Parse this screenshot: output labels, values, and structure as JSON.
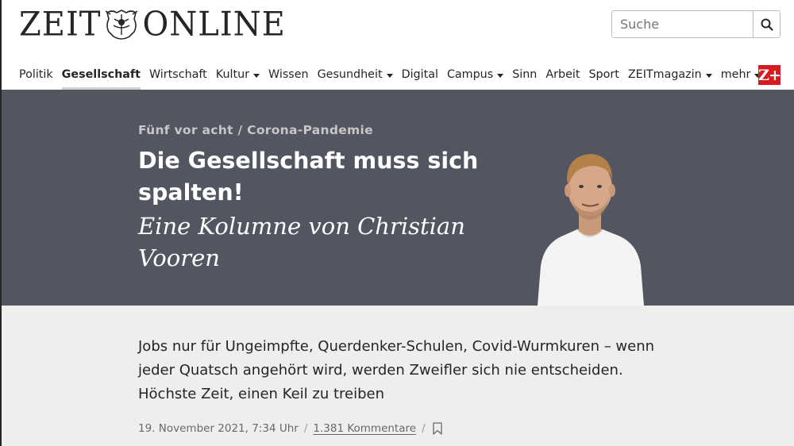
{
  "header": {
    "logo": {
      "left_word": "ZEIT",
      "right_word": "ONLINE"
    },
    "search": {
      "placeholder": "Suche",
      "button_icon": "search-icon"
    },
    "nav": [
      {
        "label": "Politik",
        "dropdown": false,
        "active": false
      },
      {
        "label": "Gesellschaft",
        "dropdown": false,
        "active": true
      },
      {
        "label": "Wirtschaft",
        "dropdown": false,
        "active": false
      },
      {
        "label": "Kultur",
        "dropdown": true,
        "active": false
      },
      {
        "label": "Wissen",
        "dropdown": false,
        "active": false
      },
      {
        "label": "Gesundheit",
        "dropdown": true,
        "active": false
      },
      {
        "label": "Digital",
        "dropdown": false,
        "active": false
      },
      {
        "label": "Campus",
        "dropdown": true,
        "active": false
      },
      {
        "label": "Sinn",
        "dropdown": false,
        "active": false
      },
      {
        "label": "Arbeit",
        "dropdown": false,
        "active": false
      },
      {
        "label": "Sport",
        "dropdown": false,
        "active": false
      },
      {
        "label": "ZEITmagazin",
        "dropdown": true,
        "active": false
      },
      {
        "label": "mehr",
        "dropdown": true,
        "active": false
      }
    ],
    "zplus_label": "Z+",
    "colors": {
      "zplus_bg": "#d71920",
      "text": "#252525"
    }
  },
  "article": {
    "kicker": "Fünf vor acht / Corona-Pandemie",
    "headline": "Die Gesellschaft muss sich spalten!",
    "subline": "Eine Kolumne von Christian Vooren",
    "summary": "Jobs nur für Ungeimpfte, Querdenker-Schulen, Covid-Wurmkuren – wenn jeder Quatsch angehört wird, werden Zweifler sich nie entscheiden. Höchste Zeit, einen Keil zu treiben",
    "date": "19. November 2021, 7:34 Uhr",
    "separator": "/",
    "comments": "1.381 Kommentare",
    "bookmark_icon": "bookmark-icon",
    "colors": {
      "hero_bg": "#535560",
      "body_bg": "#efeeec"
    }
  }
}
